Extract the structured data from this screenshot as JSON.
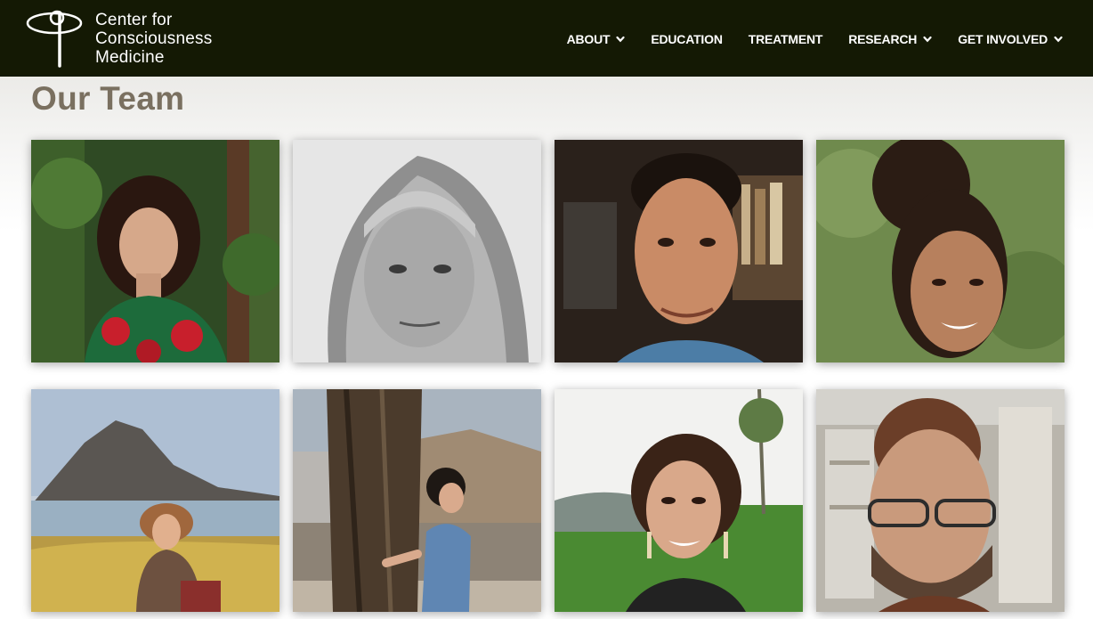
{
  "header": {
    "logo_lines": [
      "Center for",
      "Consciousness",
      "Medicine"
    ],
    "nav": [
      {
        "label": "ABOUT",
        "has_dropdown": true
      },
      {
        "label": "EDUCATION",
        "has_dropdown": false
      },
      {
        "label": "TREATMENT",
        "has_dropdown": false
      },
      {
        "label": "RESEARCH",
        "has_dropdown": true
      },
      {
        "label": "GET INVOLVED",
        "has_dropdown": true
      }
    ]
  },
  "main": {
    "title": "Our Team"
  },
  "colors": {
    "header_bg": "#141904",
    "title": "#7a7060"
  }
}
